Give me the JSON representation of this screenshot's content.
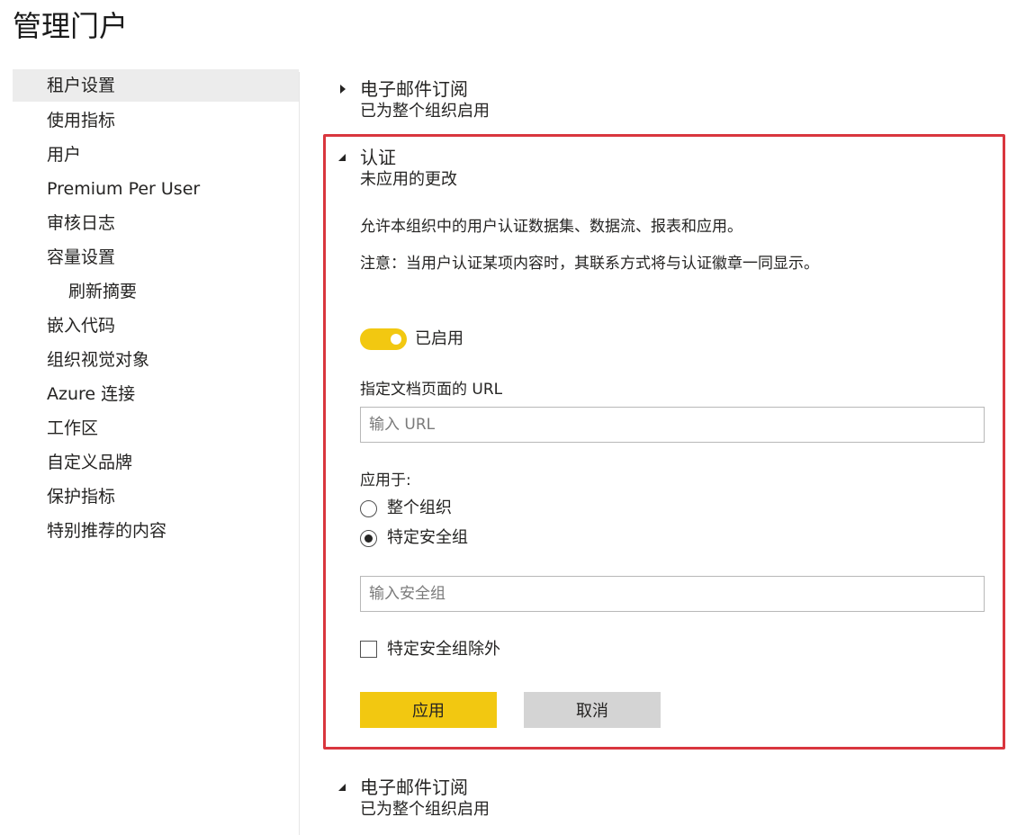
{
  "page": {
    "title": "管理门户"
  },
  "sidebar": {
    "items": [
      {
        "label": "租户设置",
        "active": true
      },
      {
        "label": "使用指标"
      },
      {
        "label": "用户"
      },
      {
        "label": "Premium Per User"
      },
      {
        "label": "审核日志"
      },
      {
        "label": "容量设置"
      },
      {
        "label": "刷新摘要",
        "sub": true
      },
      {
        "label": "嵌入代码"
      },
      {
        "label": "组织视觉对象"
      },
      {
        "label": "Azure 连接"
      },
      {
        "label": "工作区"
      },
      {
        "label": "自定义品牌"
      },
      {
        "label": "保护指标"
      },
      {
        "label": "特别推荐的内容"
      }
    ]
  },
  "sections": {
    "top": {
      "title": "电子邮件订阅",
      "status": "已为整个组织启用",
      "caret": "collapsed"
    },
    "certification": {
      "title": "认证",
      "status": "未应用的更改",
      "caret": "expanded",
      "description": "允许本组织中的用户认证数据集、数据流、报表和应用。",
      "note": "注意：当用户认证某项内容时，其联系方式将与认证徽章一同显示。",
      "toggle": {
        "label": "已启用",
        "on": true
      },
      "url_field": {
        "label": "指定文档页面的 URL",
        "value": "",
        "placeholder": "输入 URL"
      },
      "apply_to": {
        "label": "应用于:",
        "options": [
          {
            "label": "整个组织",
            "selected": false
          },
          {
            "label": "特定安全组",
            "selected": true
          }
        ]
      },
      "security_group_field": {
        "value": "",
        "placeholder": "输入安全组"
      },
      "exclude_checkbox": {
        "label": "特定安全组除外",
        "checked": false
      },
      "buttons": {
        "apply": "应用",
        "cancel": "取消"
      }
    },
    "bottom": {
      "title": "电子邮件订阅",
      "status": "已为整个组织启用",
      "caret": "expanded"
    }
  },
  "colors": {
    "accent": "#f2c811",
    "highlight_border": "#d9363e",
    "active_nav_bg": "#ececec",
    "cancel_bg": "#d4d4d4"
  }
}
